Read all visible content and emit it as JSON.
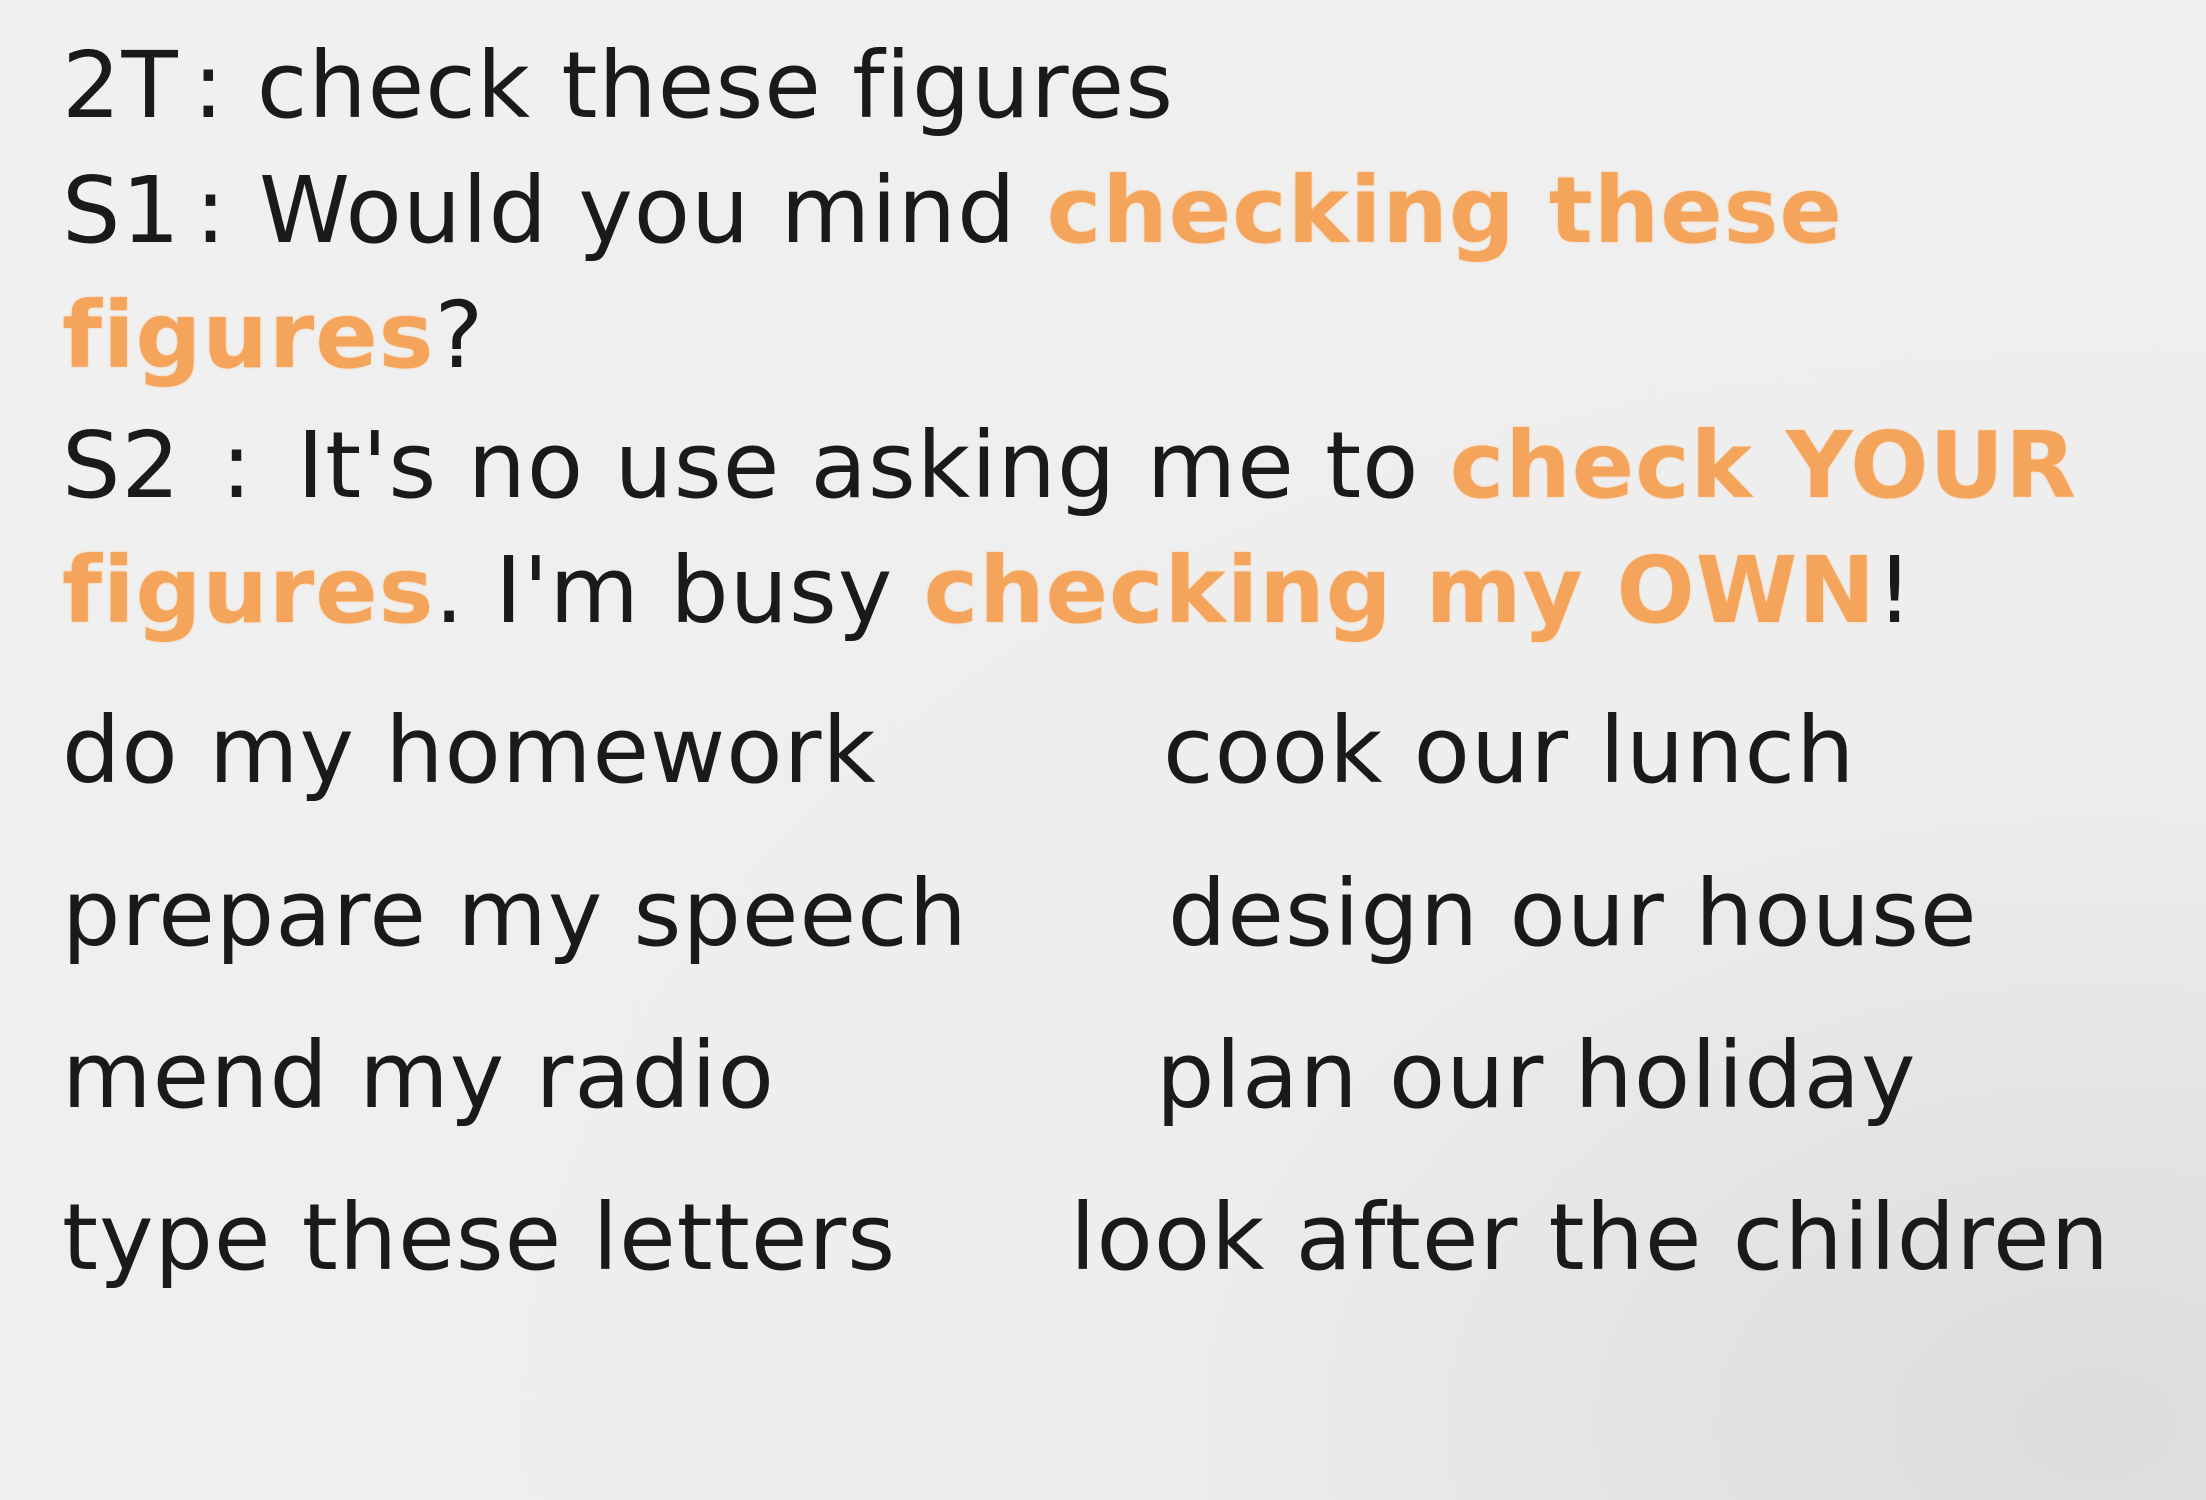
{
  "dialogue": {
    "line1": {
      "speaker": "2T",
      "colon": ":",
      "text": "check these figures"
    },
    "line2": {
      "speaker": "S1",
      "colon": ":",
      "text_a": "Would you mind ",
      "hl_a": "checking these",
      "hl_b": "figures",
      "text_b": "?"
    },
    "line3": {
      "speaker": "S2",
      "colon": ":",
      "text_a": "It's no use asking me to ",
      "hl_a": "check YOUR",
      "hl_b": "figures",
      "text_b": ". I'm busy ",
      "hl_c": "checking my OWN",
      "text_c": "!"
    }
  },
  "phrases": {
    "left": [
      "do my homework",
      "prepare my speech",
      "mend my radio",
      "type these letters"
    ],
    "right": [
      "cook our lunch",
      "design our house",
      "plan our holiday",
      "look after the children"
    ]
  },
  "colors": {
    "highlight": "#f4a55b",
    "text": "#1a1a1a",
    "background": "#eeeeee"
  }
}
